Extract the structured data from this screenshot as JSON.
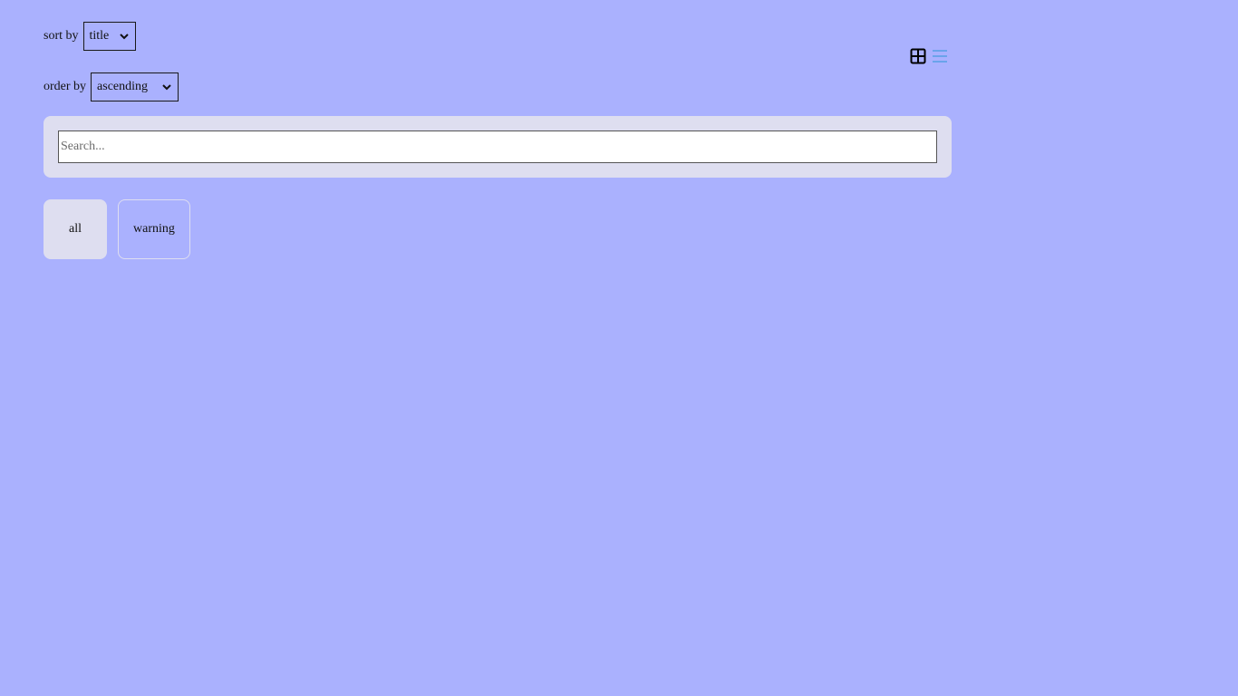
{
  "controls": {
    "sort_label": "sort by",
    "sort_value": "title",
    "order_label": "order by",
    "order_value": "ascending"
  },
  "view_toggle": {
    "grid_icon": "grid-icon",
    "list_icon": "list-icon",
    "active_color": "#000000",
    "inactive_color": "#5aa0e6"
  },
  "search": {
    "placeholder": "Search...",
    "value": ""
  },
  "filters": [
    {
      "label": "all",
      "active": true
    },
    {
      "label": "warning",
      "active": false
    }
  ],
  "colors": {
    "background": "#aab1fe",
    "panel": "#dedef0"
  }
}
